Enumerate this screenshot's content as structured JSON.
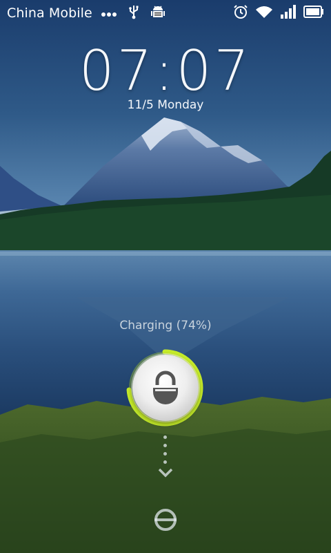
{
  "status_bar": {
    "carrier": "China Mobile",
    "icons": [
      "more-dots-icon",
      "usb-icon",
      "android-debug-icon",
      "alarm-icon",
      "wifi-icon",
      "signal-icon",
      "battery-icon"
    ]
  },
  "lockscreen": {
    "time": "07:07",
    "date": "11/5 Monday",
    "charging_text": "Charging (74%)",
    "charge_percent": 74,
    "accent_color": "#c6ec2a"
  }
}
